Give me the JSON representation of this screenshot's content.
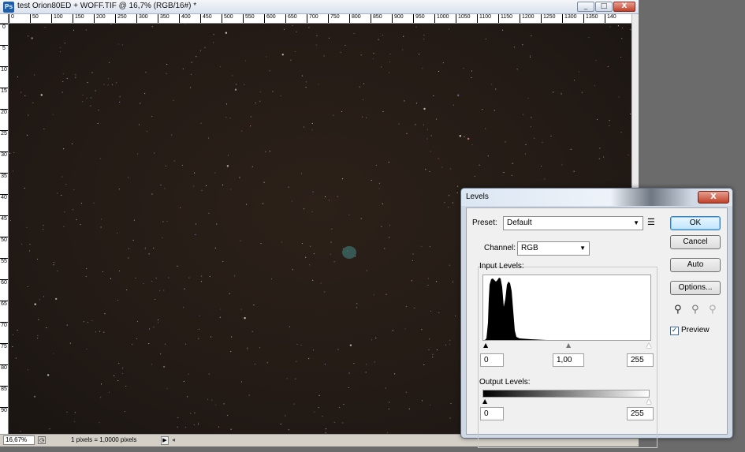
{
  "document": {
    "title": "test Orion80ED + WOFF.TIF @ 16,7% (RGB/16#) *",
    "app_icon": "Ps",
    "window_buttons": {
      "minimize": "_",
      "restore": "□",
      "close": "X"
    },
    "ruler_top": [
      "0",
      "50",
      "100",
      "150",
      "200",
      "250",
      "300",
      "350",
      "400",
      "450",
      "500",
      "550",
      "600",
      "650",
      "700",
      "750",
      "800",
      "850",
      "900",
      "950",
      "1000",
      "1050",
      "1100",
      "1150",
      "1200",
      "1250",
      "1300",
      "1350",
      "140"
    ],
    "ruler_left": [
      "0",
      "5",
      "10",
      "15",
      "20",
      "25",
      "30",
      "35",
      "40",
      "45",
      "50",
      "55",
      "60",
      "65",
      "70",
      "75",
      "80",
      "85",
      "90"
    ],
    "status": {
      "zoom": "16,67%",
      "info": "1 pixels = 1,0000 pixels",
      "arrow": "▶",
      "scroll_left": "◂"
    }
  },
  "levels_dialog": {
    "title": "Levels",
    "close_label": "X",
    "preset_label": "Preset:",
    "preset_value": "Default",
    "preset_menu_icon": "list-options-icon",
    "channel_label": "Channel:",
    "channel_value": "RGB",
    "input_levels_label": "Input Levels:",
    "input_values": {
      "black": "0",
      "gamma": "1,00",
      "white": "255"
    },
    "output_levels_label": "Output Levels:",
    "output_values": {
      "black": "0",
      "white": "255"
    },
    "buttons": {
      "ok": "OK",
      "cancel": "Cancel",
      "auto": "Auto",
      "options": "Options..."
    },
    "preview_label": "Preview",
    "preview_checked": true,
    "eyedroppers": [
      "black-point-eyedropper-icon",
      "gray-point-eyedropper-icon",
      "white-point-eyedropper-icon"
    ]
  }
}
